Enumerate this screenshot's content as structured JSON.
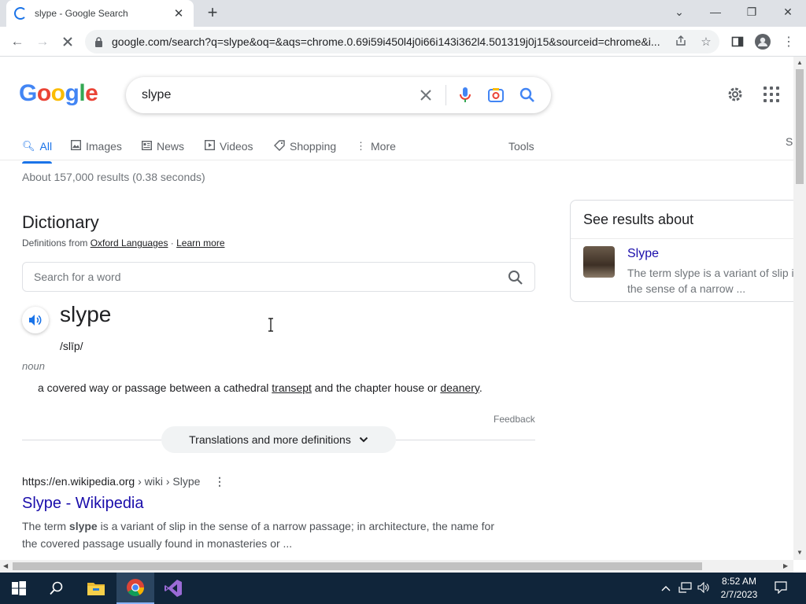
{
  "browser": {
    "tab_title": "slype - Google Search",
    "url": "google.com/search?q=slype&oq=&aqs=chrome.0.69i59i450l4j0i66i143i362l4.501319j0j15&sourceid=chrome&i..."
  },
  "search": {
    "query": "slype",
    "tabs": [
      {
        "label": "All"
      },
      {
        "label": "Images"
      },
      {
        "label": "News"
      },
      {
        "label": "Videos"
      },
      {
        "label": "Shopping"
      },
      {
        "label": "More"
      }
    ],
    "tools_label": "Tools",
    "stats": "About 157,000 results (0.38 seconds)",
    "right_edge_text": "S"
  },
  "dictionary": {
    "title": "Dictionary",
    "source_prefix": "Definitions from ",
    "source_link": "Oxford Languages",
    "separator": " · ",
    "learn_more": "Learn more",
    "search_placeholder": "Search for a word",
    "word": "slype",
    "phonetic": "/slīp/",
    "part_of_speech": "noun",
    "definition_part1": "a covered way or passage between a cathedral ",
    "definition_link1": "transept",
    "definition_part2": " and the chapter house or ",
    "definition_link2": "deanery",
    "definition_part3": ".",
    "feedback": "Feedback",
    "more_definitions": "Translations and more definitions"
  },
  "result": {
    "cite_domain": "https://en.wikipedia.org",
    "cite_path": " › wiki › Slype",
    "title": "Slype - Wikipedia",
    "snippet_pre": "The term ",
    "snippet_bold": "slype",
    "snippet_post": " is a variant of slip in the sense of a narrow passage; in architecture, the name for the covered passage usually found in monasteries or ..."
  },
  "knowledge_panel": {
    "header": "See results about",
    "title": "Slype",
    "description": "The term slype is a variant of slip in the sense of a narrow ..."
  },
  "taskbar": {
    "time": "8:52 AM",
    "date": "2/7/2023"
  },
  "colors": {
    "link": "#1a0dab",
    "accent": "#1a73e8",
    "taskbar": "#10253a"
  }
}
